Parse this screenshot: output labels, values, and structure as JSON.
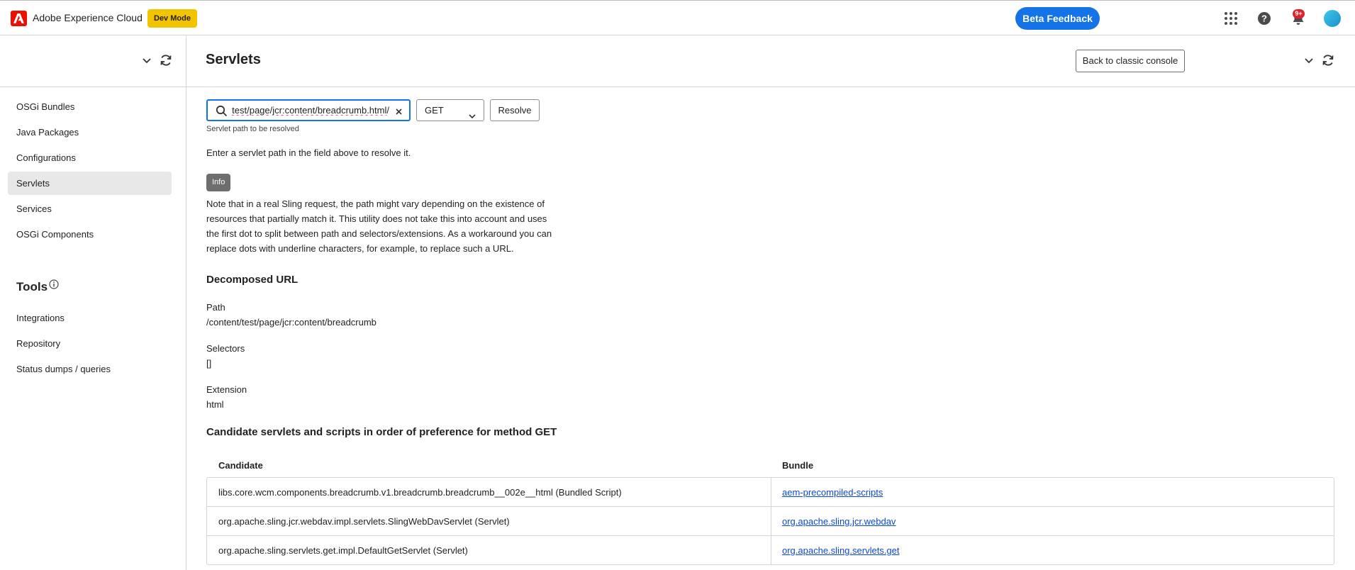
{
  "topbar": {
    "app_title": "Adobe Experience Cloud",
    "dev_mode": "Dev Mode",
    "beta_feedback": "Beta Feedback",
    "notification_count": "9+",
    "icons": [
      "app-switcher-icon",
      "help-icon",
      "bell-icon",
      "avatar"
    ]
  },
  "sidebar": {
    "items": [
      {
        "label": "OSGi Bundles",
        "active": false
      },
      {
        "label": "Java Packages",
        "active": false
      },
      {
        "label": "Configurations",
        "active": false
      },
      {
        "label": "Servlets",
        "active": true
      },
      {
        "label": "Services",
        "active": false
      },
      {
        "label": "OSGi Components",
        "active": false
      }
    ],
    "tools_heading": "Tools",
    "tools_items": [
      {
        "label": "Integrations"
      },
      {
        "label": "Repository"
      },
      {
        "label": "Status dumps / queries"
      }
    ]
  },
  "main": {
    "title": "Servlets",
    "classic_button": "Back to classic console",
    "search": {
      "value": "/content/test/page/jcr:content/breadcrumb.html",
      "help": "Servlet path to be resolved"
    },
    "method": "GET",
    "resolve_button": "Resolve",
    "instruction": "Enter a servlet path in the field above to resolve it.",
    "info_badge": "Info",
    "note": "Note that in a real Sling request, the path might vary depending on the existence of resources that partially match it. This utility does not take this into account and uses the first dot to split between path and selectors/extensions. As a workaround you can replace dots with underline characters, for example, to replace such a URL.",
    "decomposed_title": "Decomposed URL",
    "path_label": "Path",
    "path_value": "/content/test/page/jcr:content/breadcrumb",
    "selectors_label": "Selectors",
    "selectors_value": "[]",
    "extension_label": "Extension",
    "extension_value": "html",
    "candidates_title": "Candidate servlets and scripts in order of preference for method GET",
    "table": {
      "headers": [
        "Candidate",
        "Bundle"
      ],
      "rows": [
        {
          "candidate": "libs.core.wcm.components.breadcrumb.v1.breadcrumb.breadcrumb__002e__html (Bundled Script)",
          "bundle": "aem-precompiled-scripts"
        },
        {
          "candidate": "org.apache.sling.jcr.webdav.impl.servlets.SlingWebDavServlet (Servlet)",
          "bundle": "org.apache.sling.jcr.webdav"
        },
        {
          "candidate": "org.apache.sling.servlets.get.impl.DefaultGetServlet (Servlet)",
          "bundle": "org.apache.sling.servlets.get"
        }
      ]
    }
  },
  "colors": {
    "brand": "#eb1000",
    "accent": "#1473e6",
    "dev_mode": "#f2c400",
    "link": "#0a49d8"
  }
}
